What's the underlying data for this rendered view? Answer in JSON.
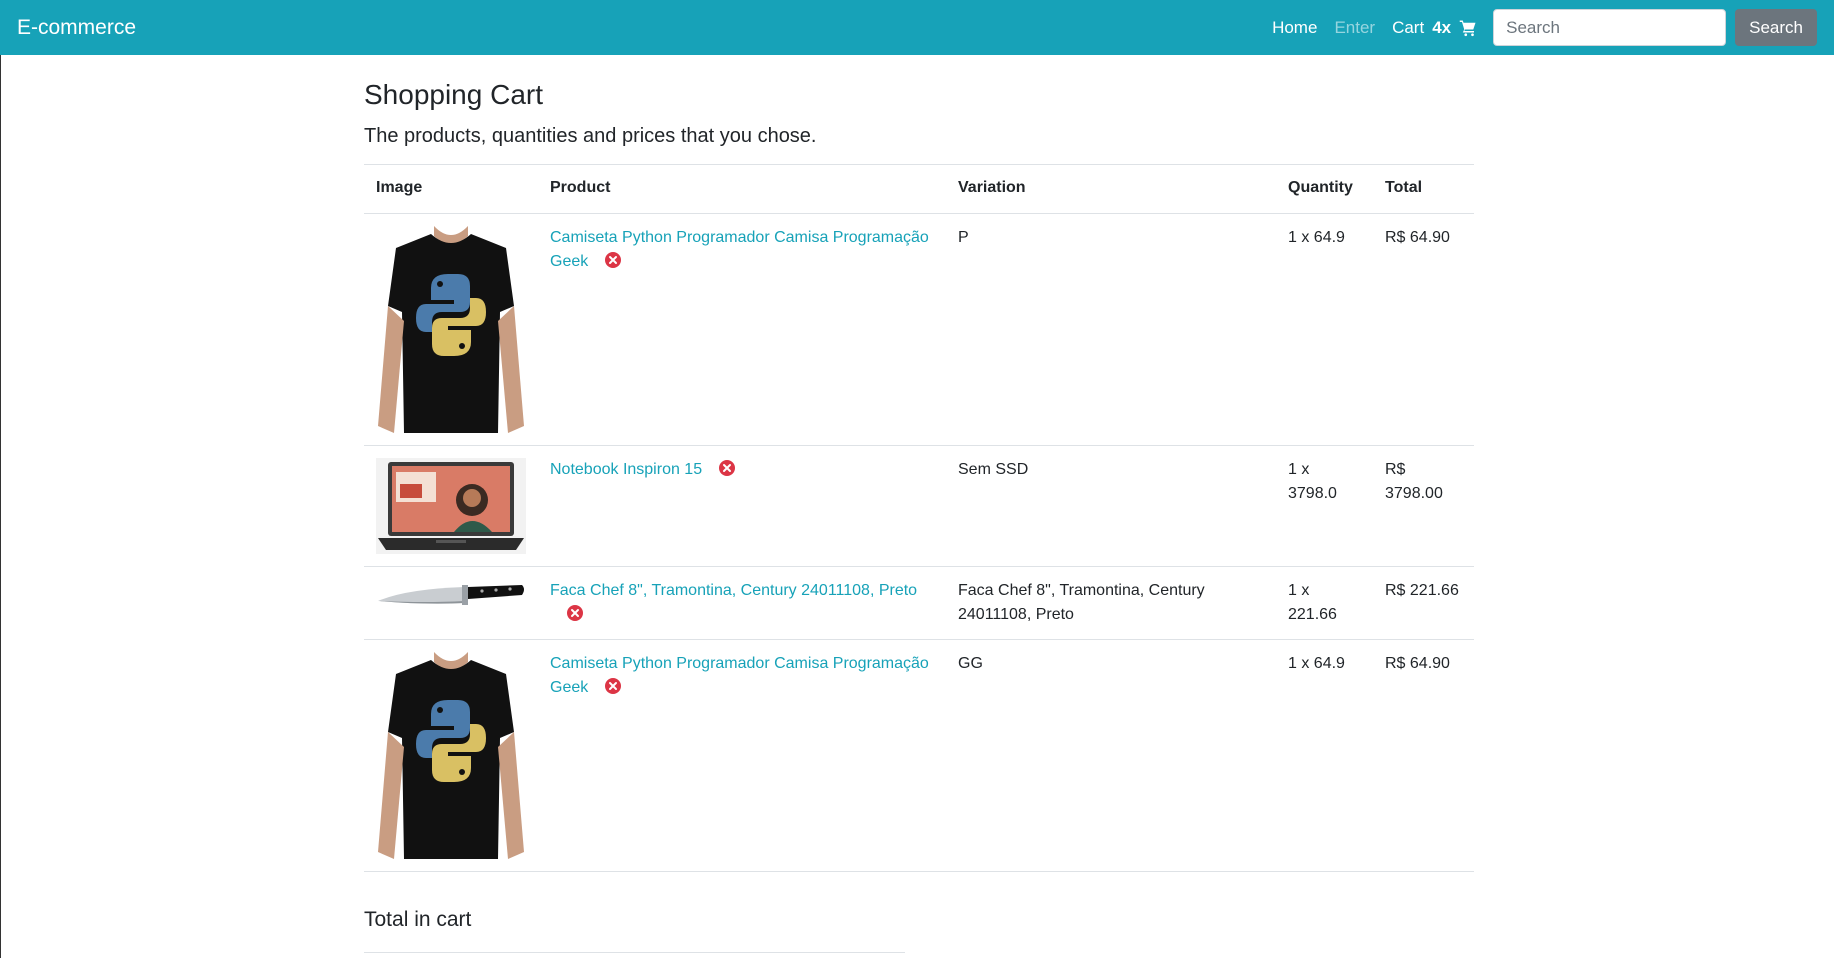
{
  "navbar": {
    "brand": "E-commerce",
    "links": {
      "home": "Home",
      "enter": "Enter",
      "cart": "Cart"
    },
    "cart_count": "4x",
    "search_placeholder": "Search",
    "search_button": "Search",
    "bg_color": "#17a2b8"
  },
  "page": {
    "title": "Shopping Cart",
    "lead": "The products, quantities and prices that you chose."
  },
  "table": {
    "headers": {
      "image": "Image",
      "product": "Product",
      "variation": "Variation",
      "quantity": "Quantity",
      "total": "Total"
    },
    "rows": [
      {
        "product": "Camiseta Python Programador Camisa Programação Geek",
        "variation": "P",
        "quantity": "1 x 64.9",
        "total": "R$ 64.90",
        "image": "tshirt-python"
      },
      {
        "product": "Notebook Inspiron 15",
        "variation": "Sem SSD",
        "quantity": "1 x 3798.0",
        "total": "R$ 3798.00",
        "image": "laptop"
      },
      {
        "product": "Faca Chef 8\", Tramontina, Century 24011108, Preto",
        "variation": "Faca Chef 8\", Tramontina, Century 24011108, Preto",
        "quantity": "1 x 221.66",
        "total": "R$ 221.66",
        "image": "chef-knife"
      },
      {
        "product": "Camiseta Python Programador Camisa Programação Geek",
        "variation": "GG",
        "quantity": "1 x 64.9",
        "total": "R$ 64.90",
        "image": "tshirt-python"
      }
    ]
  },
  "summary": {
    "title": "Total in cart"
  },
  "colors": {
    "link": "#17a2b8",
    "remove": "#dc3545"
  }
}
